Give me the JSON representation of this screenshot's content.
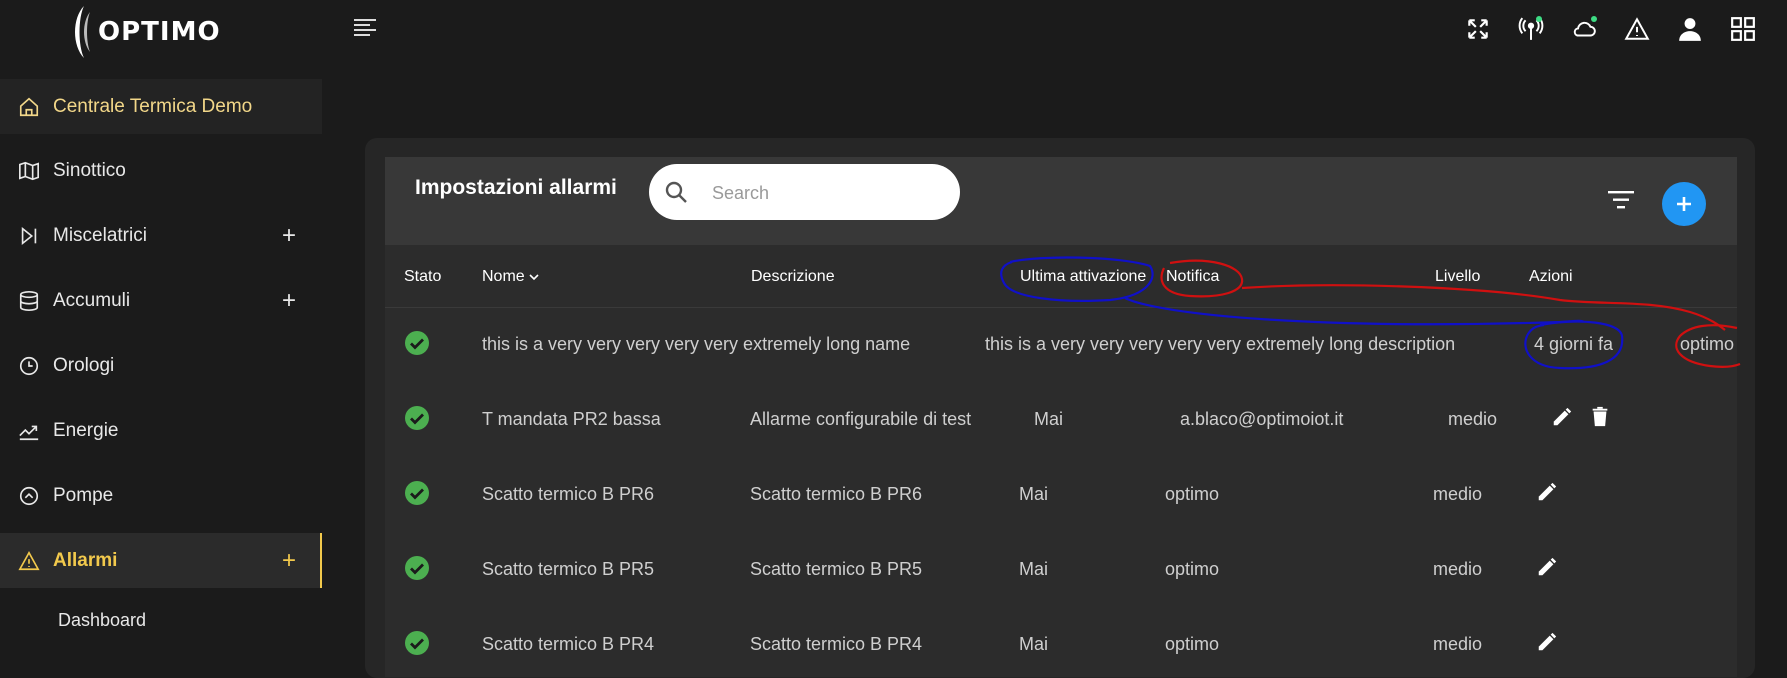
{
  "app": {
    "logo_text": "OPTIMO"
  },
  "sidebar": {
    "home": "Centrale Termica Demo",
    "items": [
      {
        "label": "Sinottico",
        "icon": "map-icon"
      },
      {
        "label": "Miscelatrici",
        "icon": "step-forward-icon",
        "plus": "+"
      },
      {
        "label": "Accumuli",
        "icon": "database-icon",
        "plus": "+"
      },
      {
        "label": "Orologi",
        "icon": "clock-icon"
      },
      {
        "label": "Energie",
        "icon": "trend-icon"
      },
      {
        "label": "Pompe",
        "icon": "pump-icon"
      },
      {
        "label": "Allarmi",
        "icon": "warning-icon",
        "plus": "+"
      }
    ],
    "sub_dashboard": "Dashboard"
  },
  "panel": {
    "title": "Impostazioni allarmi",
    "search_placeholder": "Search"
  },
  "table": {
    "headers": {
      "stato": "Stato",
      "nome": "Nome",
      "descrizione": "Descrizione",
      "ultima": "Ultima attivazione",
      "notifica": "Notifica",
      "livello": "Livello",
      "azioni": "Azioni"
    },
    "rows": [
      {
        "nome": "this is a very very very very very extremely long name",
        "descrizione": "this is a very very very very very extremely long description",
        "ultima": "4 giorni fa",
        "notifica": "optimo",
        "livello": ""
      },
      {
        "nome": "T mandata PR2 bassa",
        "descrizione": "Allarme configurabile di test",
        "ultima": "Mai",
        "notifica": "a.blaco@optimoiot.it",
        "livello": "medio"
      },
      {
        "nome": "Scatto termico B PR6",
        "descrizione": "Scatto termico B PR6",
        "ultima": "Mai",
        "notifica": "optimo",
        "livello": "medio"
      },
      {
        "nome": "Scatto termico B PR5",
        "descrizione": "Scatto termico B PR5",
        "ultima": "Mai",
        "notifica": "optimo",
        "livello": "medio"
      },
      {
        "nome": "Scatto termico B PR4",
        "descrizione": "Scatto termico B PR4",
        "ultima": "Mai",
        "notifica": "optimo",
        "livello": "medio"
      }
    ]
  },
  "colors": {
    "accent": "#f2c94c",
    "primary_button": "#2196f3",
    "status_ok": "#4caf50",
    "annotation_blue": "#1010c8",
    "annotation_red": "#d01010"
  }
}
